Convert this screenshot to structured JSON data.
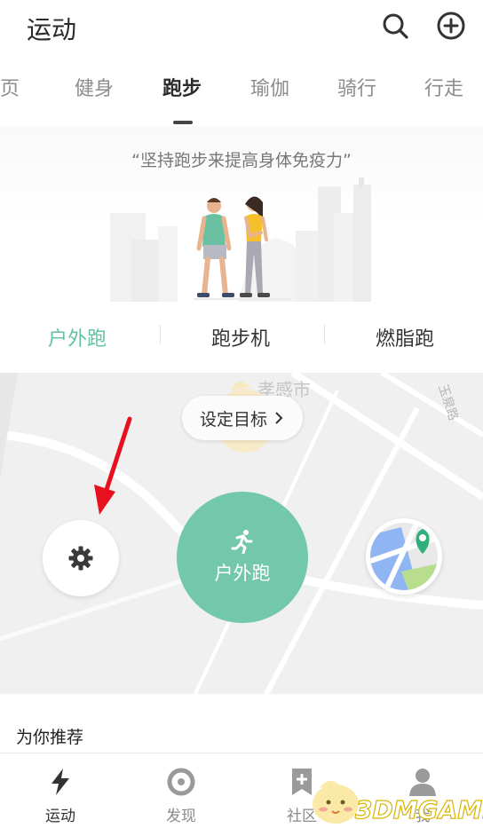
{
  "header": {
    "title": "运动",
    "icons": [
      "search-icon",
      "add-circle-icon"
    ]
  },
  "tabs": [
    {
      "label": "主页",
      "active": false
    },
    {
      "label": "健身",
      "active": false
    },
    {
      "label": "跑步",
      "active": true
    },
    {
      "label": "瑜伽",
      "active": false
    },
    {
      "label": "骑行",
      "active": false
    },
    {
      "label": "行走",
      "active": false
    }
  ],
  "banner": {
    "slogan": "“坚持跑步来提高身体免疫力”"
  },
  "modes": [
    {
      "label": "户外跑",
      "active": true
    },
    {
      "label": "跑步机",
      "active": false
    },
    {
      "label": "燃脂跑",
      "active": false
    }
  ],
  "map": {
    "city_label": "孝感市",
    "road_label": "玉泉路",
    "goal_button": "设定目标",
    "start_button": "户外跑"
  },
  "recommend": {
    "title": "为你推荐"
  },
  "bottom_nav": [
    {
      "label": "运动",
      "icon": "lightning-icon",
      "active": true
    },
    {
      "label": "发现",
      "icon": "discover-icon",
      "active": false
    },
    {
      "label": "社区",
      "icon": "community-icon",
      "active": false
    },
    {
      "label": "我",
      "icon": "profile-icon",
      "active": false
    }
  ],
  "watermark": {
    "text": "3DMGAME"
  },
  "colors": {
    "accent": "#73c7aa",
    "accent_text": "#63c2a0",
    "arrow": "#e8101e"
  }
}
